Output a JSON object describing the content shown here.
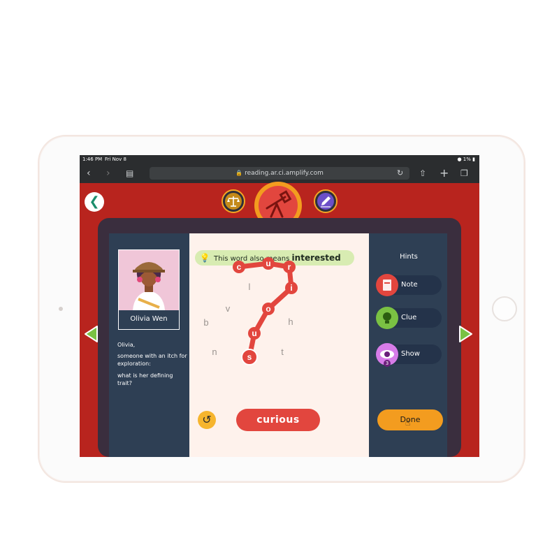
{
  "status": {
    "time": "1:46 PM",
    "date": "Fri Nov 8",
    "battery": "1%"
  },
  "browser": {
    "url": "reading.ar.ci.amplify.com"
  },
  "character": {
    "name": "Olivia Wen"
  },
  "prompt": {
    "line1": "Olivia,",
    "line2": "someone with an itch for exploration:",
    "line3": "what is her defining trait?"
  },
  "clue": {
    "prefix": "This word also means",
    "word": "interested"
  },
  "hints": {
    "title": "Hints",
    "note": "Note",
    "clue": "Clue",
    "show": "Show",
    "show_count": "3"
  },
  "puzzle": {
    "path_letters": [
      "c",
      "u",
      "r",
      "i",
      "o",
      "u",
      "s"
    ],
    "extra_letters": [
      "l",
      "v",
      "b",
      "h",
      "n",
      "t"
    ]
  },
  "answer": "curious",
  "done_label": "Done",
  "colors": {
    "accent_red": "#e2463e",
    "frame_red": "#b8241e",
    "panel": "#2e3f54",
    "done": "#f39c1f",
    "clue_bg": "#d8ecb2"
  }
}
